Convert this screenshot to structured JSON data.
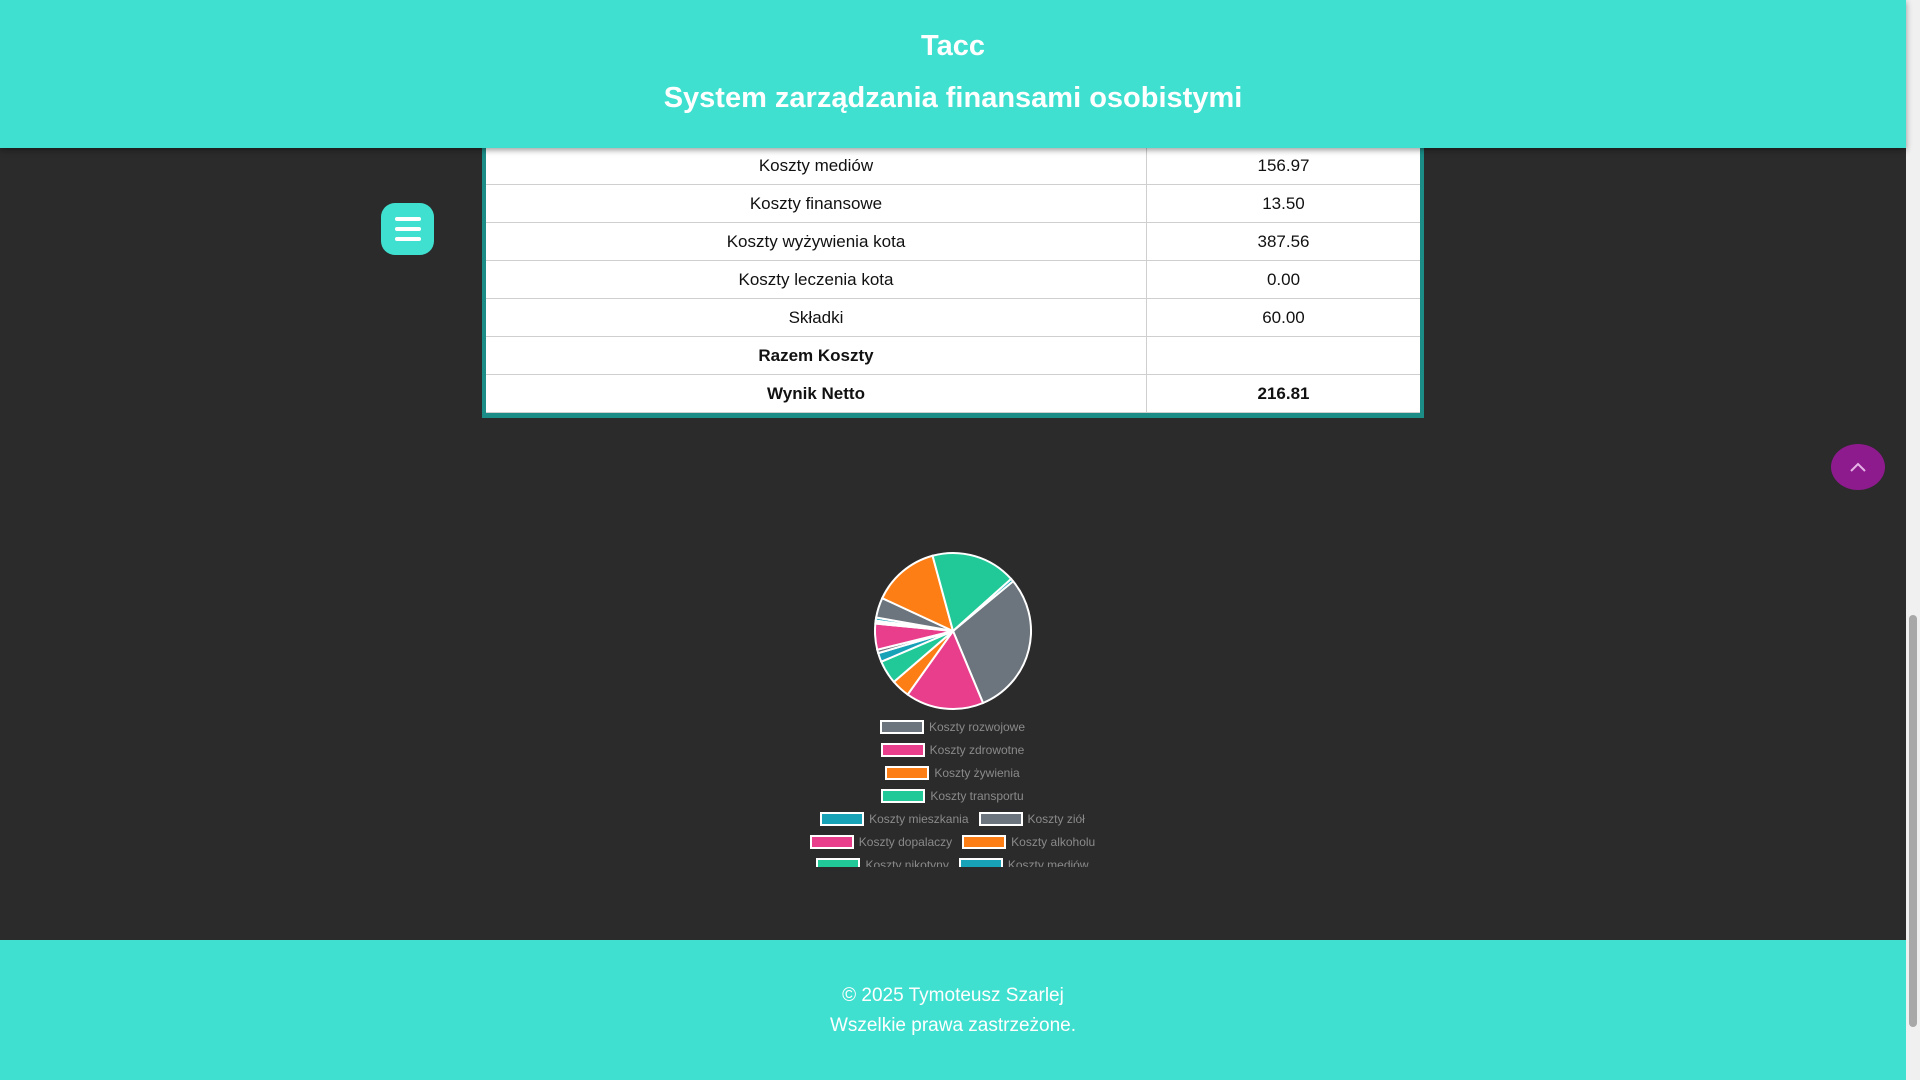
{
  "header": {
    "brand": "Tacc",
    "subtitle": "System zarządzania finansami osobistymi"
  },
  "menu": {
    "icon": "hamburger-icon"
  },
  "table": {
    "rows": [
      {
        "label": "Koszty mediów",
        "value": "156.97",
        "bold": false
      },
      {
        "label": "Koszty finansowe",
        "value": "13.50",
        "bold": false
      },
      {
        "label": "Koszty wyżywienia kota",
        "value": "387.56",
        "bold": false
      },
      {
        "label": "Koszty leczenia kota",
        "value": "0.00",
        "bold": false
      },
      {
        "label": "Składki",
        "value": "60.00",
        "bold": false
      },
      {
        "label": "Razem Koszty",
        "value": "",
        "bold": true
      },
      {
        "label": "Wynik Netto",
        "value": "216.81",
        "bold": true
      }
    ]
  },
  "scroll_top": {
    "icon": "chevron-up-icon",
    "color": "#8e1b8e"
  },
  "chart_data": {
    "type": "pie",
    "series": [
      {
        "name": "Koszty rozwojowe",
        "value": 28.7,
        "color": "#6c757d"
      },
      {
        "name": "Koszty zdrowotne",
        "value": 15.6,
        "color": "#e83e8c"
      },
      {
        "name": "Koszty żywienia",
        "value": 3.7,
        "color": "#fd7e14"
      },
      {
        "name": "Koszty transportu",
        "value": 4.7,
        "color": "#20c997"
      },
      {
        "name": "Koszty mieszkania",
        "value": 1.8,
        "color": "#17a2b8"
      },
      {
        "name": "Koszty ziół",
        "value": 0.7,
        "color": "#6c757d"
      },
      {
        "name": "Koszty dopalaczy",
        "value": 5.2,
        "color": "#e83e8c"
      },
      {
        "name": "Koszty alkoholu",
        "value": 0.3,
        "color": "#fd7e14"
      },
      {
        "name": "Koszty nikotyny",
        "value": 0.3,
        "color": "#20c997"
      },
      {
        "name": "Koszty mediów",
        "value": 0.6,
        "color": "#17a2b8"
      },
      {
        "name": "",
        "value": 4.0,
        "color": "#6c757d"
      },
      {
        "name": "",
        "value": 13.4,
        "color": "#fd7e14"
      },
      {
        "name": "",
        "value": 17.0,
        "color": "#20c997"
      },
      {
        "name": "",
        "value": 0.6,
        "color": "#17a2b8"
      }
    ],
    "legend_position": "bottom"
  },
  "footer": {
    "copyright": "© 2025 Tymoteusz Szarlej",
    "rights": "Wszelkie prawa zastrzeżone."
  }
}
